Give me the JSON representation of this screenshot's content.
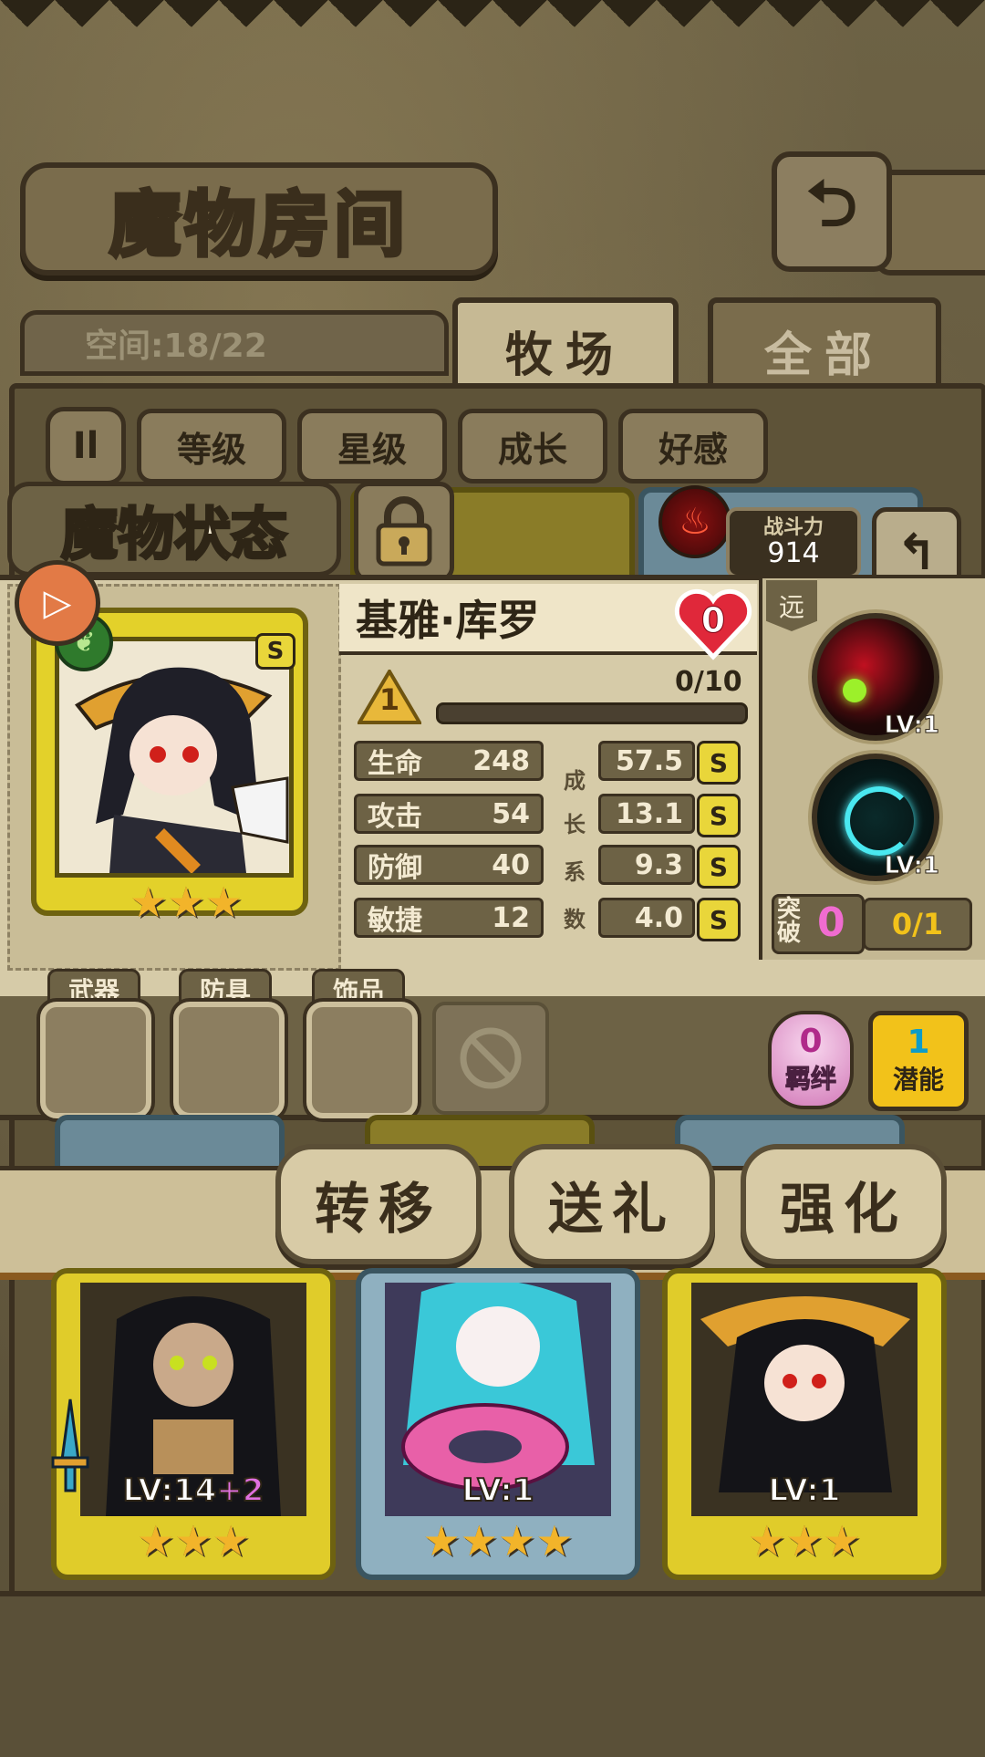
{
  "header": {
    "title": "魔物房间",
    "space_label": "空间:18/22"
  },
  "tabs": [
    {
      "label": "牧场",
      "active": true
    },
    {
      "label": "全部",
      "active": false
    }
  ],
  "sort_buttons": [
    "等级",
    "星级",
    "成长",
    "好感"
  ],
  "sort_toggle_icon": "Il",
  "status_title": "魔物状态",
  "combat": {
    "label": "战斗力",
    "value": "914"
  },
  "monster": {
    "name": "基雅·库罗",
    "affection": "0",
    "level": "1",
    "exp": "0/10",
    "rank": "S",
    "stars": 3,
    "element_icon": "leaf-icon",
    "stats": [
      {
        "label": "生命",
        "value": "248",
        "growth": "57.5",
        "grade": "S"
      },
      {
        "label": "攻击",
        "value": "54",
        "growth": "13.1",
        "grade": "S"
      },
      {
        "label": "防御",
        "value": "40",
        "growth": "9.3",
        "grade": "S"
      },
      {
        "label": "敏捷",
        "value": "12",
        "growth": "4.0",
        "grade": "S"
      }
    ],
    "growth_coef_chars": [
      "成",
      "长",
      "系",
      "数"
    ],
    "range": "远",
    "skills": [
      {
        "icon": "red-green-orb-icon",
        "level": "LV:1"
      },
      {
        "icon": "cyan-swirl-icon",
        "level": "LV:1"
      }
    ],
    "breakthrough": {
      "label": "突破",
      "count": "0",
      "progress": "0/1"
    }
  },
  "equipment": {
    "slots": [
      "武器",
      "防具",
      "饰品"
    ],
    "bond": {
      "count": "0",
      "label": "羁绊"
    },
    "potential": {
      "count": "1",
      "label": "潜能"
    }
  },
  "actions": [
    "转移",
    "送礼",
    "强化"
  ],
  "bottom_cards": [
    {
      "level": "LV:14",
      "bonus": "+2",
      "stars": 3,
      "frame": "#e0cc2a"
    },
    {
      "level": "LV:1",
      "bonus": "",
      "stars": 4,
      "frame": "#8fb0c0"
    },
    {
      "level": "LV:1",
      "bonus": "",
      "stars": 3,
      "frame": "#e0cc2a"
    }
  ],
  "colors": {
    "gold_frame": "#e3d12a",
    "blue_frame": "#8fb0c0",
    "bond_pink": "#d27ab8",
    "potential_gold": "#f2c21a"
  }
}
